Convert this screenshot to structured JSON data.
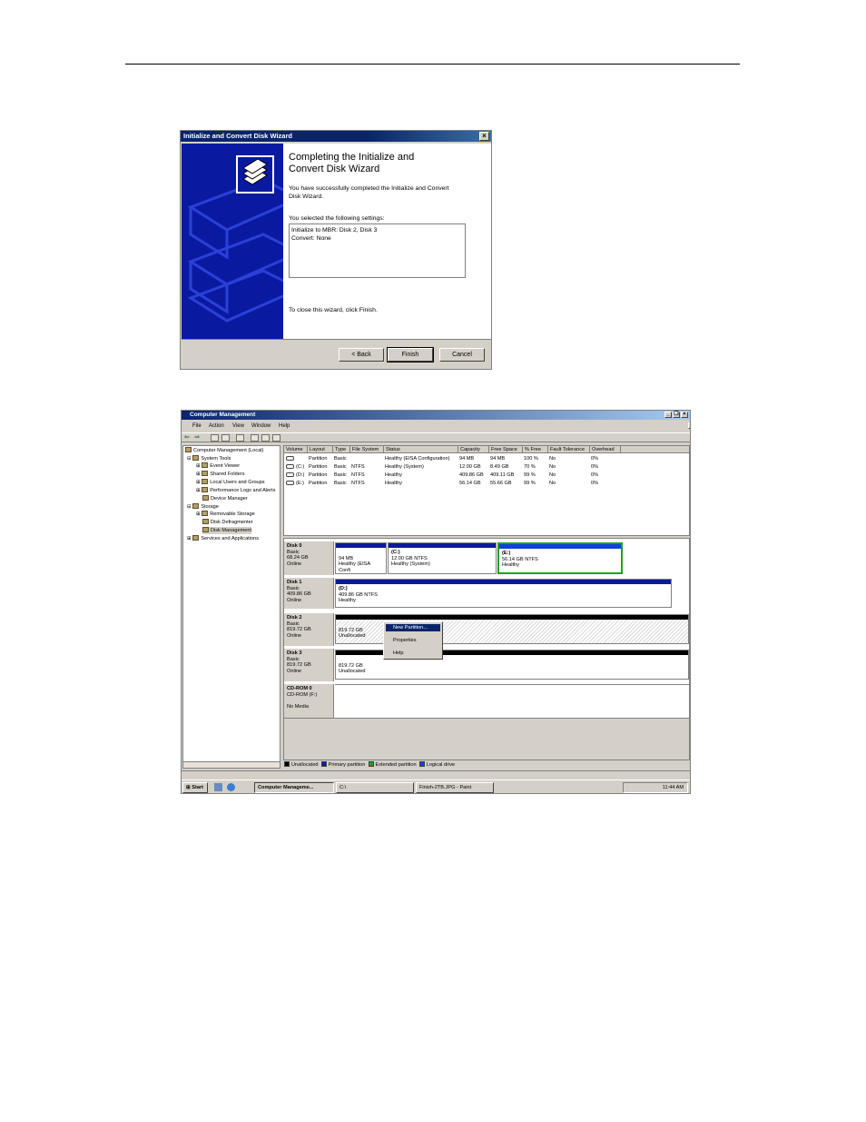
{
  "wizard": {
    "title": "Initialize and Convert Disk Wizard",
    "heading_line1": "Completing the Initialize and",
    "heading_line2": "Convert Disk Wizard",
    "success_line1": "You have successfully completed the Initialize and Convert",
    "success_line2": "Disk Wizard.",
    "settings_label": "You selected the following settings:",
    "settings_line1": "Initialize to MBR: Disk 2, Disk 3",
    "settings_line2": "Convert: None",
    "close_text": "To close this wizard, click Finish.",
    "back_label": "< Back",
    "finish_label": "Finish",
    "cancel_label": "Cancel",
    "close_glyph": "×"
  },
  "cm": {
    "title": "Computer Management",
    "menu": [
      "File",
      "Action",
      "View",
      "Window",
      "Help"
    ],
    "win_buttons": [
      "_",
      "❐",
      "×"
    ],
    "tree": [
      "Computer Management (Local)",
      "System Tools",
      "Event Viewer",
      "Shared Folders",
      "Local Users and Groups",
      "Performance Logs and Alerts",
      "Device Manager",
      "Storage",
      "Removable Storage",
      "Disk Defragmenter",
      "Disk Management",
      "Services and Applications"
    ],
    "columns": [
      "Volume",
      "Layout",
      "Type",
      "File System",
      "Status",
      "Capacity",
      "Free Space",
      "% Free",
      "Fault Tolerance",
      "Overhead"
    ],
    "volumes": [
      [
        "",
        "Partition",
        "Basic",
        "",
        "Healthy (EISA Configuration)",
        "94 MB",
        "94 MB",
        "100 %",
        "No",
        "0%"
      ],
      [
        "(C:)",
        "Partition",
        "Basic",
        "NTFS",
        "Healthy (System)",
        "12.00 GB",
        "8.49 GB",
        "70 %",
        "No",
        "0%"
      ],
      [
        "(D:)",
        "Partition",
        "Basic",
        "NTFS",
        "Healthy",
        "409.86 GB",
        "409.11 GB",
        "99 %",
        "No",
        "0%"
      ],
      [
        "(E:)",
        "Partition",
        "Basic",
        "NTFS",
        "Healthy",
        "56.14 GB",
        "55.66 GB",
        "99 %",
        "No",
        "0%"
      ]
    ],
    "disks": [
      {
        "name": "Disk 0",
        "type": "Basic",
        "size": "68.24 GB",
        "status": "Online"
      },
      {
        "name": "Disk 1",
        "type": "Basic",
        "size": "409.86 GB",
        "status": "Online"
      },
      {
        "name": "Disk 2",
        "type": "Basic",
        "size": "819.72 GB",
        "status": "Online"
      },
      {
        "name": "Disk 3",
        "type": "Basic",
        "size": "819.72 GB",
        "status": "Online"
      },
      {
        "name": "CD-ROM 0",
        "type": "CD-ROM (F:)",
        "size": "",
        "status": "No Media"
      }
    ],
    "partitions": {
      "d0p1": {
        "size": "94 MB",
        "status": "Healthy (EISA Confi"
      },
      "d0p2": {
        "name": "(C:)",
        "size": "12.00 GB NTFS",
        "status": "Healthy (System)"
      },
      "d0p3": {
        "name": "(E:)",
        "size": "56.14 GB NTFS",
        "status": "Healthy"
      },
      "d1p1": {
        "name": "(D:)",
        "size": "409.86 GB NTFS",
        "status": "Healthy"
      },
      "d2p1": {
        "size": "819.72 GB",
        "status": "Unallocated"
      },
      "d3p1": {
        "size": "819.72 GB",
        "status": "Unallocated"
      }
    },
    "context_menu": [
      "New Partition...",
      "Properties",
      "Help"
    ],
    "legend": [
      "Unallocated",
      "Primary partition",
      "Extended partition",
      "Logical drive"
    ],
    "legend_colors": [
      "#000000",
      "#0a1aa0",
      "#20a020",
      "#1040e0"
    ],
    "taskbar": {
      "start": "Start",
      "items": [
        "Computer Manageme...",
        "C:\\",
        "Finish-2TB.JPG - Paint"
      ],
      "clock": "11:44 AM"
    }
  }
}
